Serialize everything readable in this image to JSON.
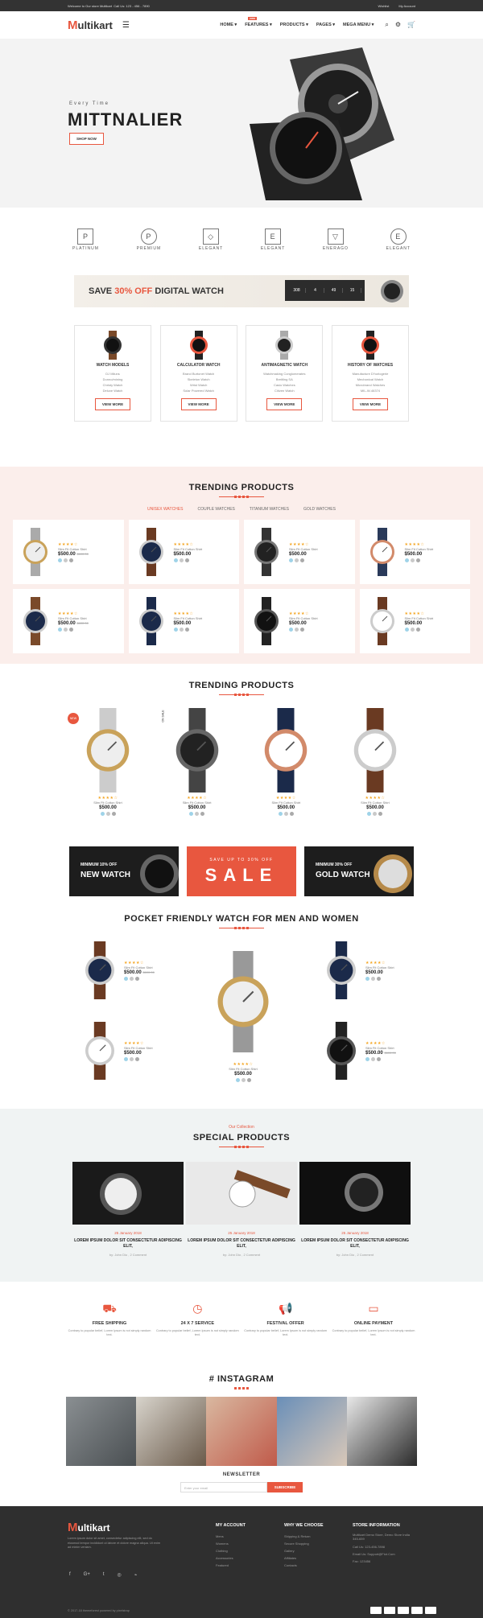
{
  "topbar": {
    "welcome": "Welcome to Our store Multikart",
    "phone": "Call Us: 123 - 456 - 7890",
    "wishlist": "Wishlist",
    "account": "My Account"
  },
  "header": {
    "logo_m": "M",
    "logo_rest": "ultikart",
    "nav": [
      "HOME",
      "FEATURES",
      "PRODUCTS",
      "PAGES",
      "MEGA MENU"
    ],
    "hot_badge": "new"
  },
  "hero": {
    "subtitle": "Every Time",
    "title": "MITTNALIER",
    "button": "SHOP NOW"
  },
  "brands": [
    {
      "mark": "P",
      "name": "PLATINUM"
    },
    {
      "mark": "P",
      "name": "PREMIUM"
    },
    {
      "mark": "◇",
      "name": "ELEGANT"
    },
    {
      "mark": "E",
      "name": "ELEGANT"
    },
    {
      "mark": "▽",
      "name": "ENERAGO"
    },
    {
      "mark": "E",
      "name": "ELEGANT"
    }
  ],
  "promo": {
    "pre": "SAVE ",
    "highlight": "30% OFF",
    "post": " DIGITAL WATCH",
    "countdown": [
      "308",
      "4",
      "49",
      "15"
    ]
  },
  "categories": [
    {
      "name": "WATCH MODELS",
      "items": [
        "DJ Miluns",
        "Dunno/mining",
        "Christy Watch",
        "Deluxe Watch"
      ],
      "button": "VIEW MORE"
    },
    {
      "name": "CALCULATOR WATCH",
      "items": [
        "Brand Burtonet Watch",
        "Skeleton Watch",
        "Wrist Watch",
        "Solar Powered Watch"
      ],
      "button": "VIEW MORE"
    },
    {
      "name": "ANTIMAGNETIC WATCH",
      "items": [
        "Watchmaking Conglomerates",
        "Breitling SA",
        "Casio Watches",
        "Citizen Watch"
      ],
      "button": "VIEW MORE"
    },
    {
      "name": "HISTORY OF WATCHES",
      "items": [
        "Manufacture D'horlogerie",
        "Mechanical Watch",
        "Microbrand Watches",
        "MIL-W-46374"
      ],
      "button": "VIEW MORE"
    }
  ],
  "trending1": {
    "title": "TRENDING PRODUCTS",
    "tabs": [
      "UNISEX WATCHES",
      "COUPLE WATCHES",
      "TITANIUM WATCHES",
      "GOLD WATCHES"
    ],
    "products": [
      {
        "name": "Slim Fit Cotton Shirt",
        "price": "$500.00",
        "old": "$600.00",
        "rating": 4
      },
      {
        "name": "Slim Fit Cotton Shirt",
        "price": "$500.00",
        "old": "",
        "rating": 4
      },
      {
        "name": "Slim Fit Cotton Shirt",
        "price": "$500.00",
        "old": "",
        "rating": 4
      },
      {
        "name": "Slim Fit Cotton Shirt",
        "price": "$500.00",
        "old": "",
        "rating": 4
      },
      {
        "name": "Slim Fit Cotton Shirt",
        "price": "$500.00",
        "old": "$600.00",
        "rating": 4
      },
      {
        "name": "Slim Fit Cotton Shirt",
        "price": "$500.00",
        "old": "",
        "rating": 4
      },
      {
        "name": "Slim Fit Cotton Shirt",
        "price": "$500.00",
        "old": "",
        "rating": 4
      },
      {
        "name": "Slim Fit Cotton Shirt",
        "price": "$500.00",
        "old": "",
        "rating": 4
      }
    ]
  },
  "trending2": {
    "title": "TRENDING PRODUCTS",
    "new_badge": "NEW",
    "sale_badge": "ON SALE",
    "products": [
      {
        "name": "Slim Fit Cotton Shirt",
        "price": "$500.00"
      },
      {
        "name": "Slim Fit Cotton Shirt",
        "price": "$500.00"
      },
      {
        "name": "Slim Fit Cotton Shirt",
        "price": "$500.00"
      },
      {
        "name": "Slim Fit Cotton Shirt",
        "price": "$500.00"
      }
    ]
  },
  "banners": [
    {
      "small": "MINIMUM 10% OFF",
      "large": "NEW WATCH"
    },
    {
      "small": "SAVE UP TO 30% OFF",
      "large": "SALE"
    },
    {
      "small": "MINIMUM 30% OFF",
      "large": "GOLD WATCH"
    }
  ],
  "pocket": {
    "title": "POCKET FRIENDLY WATCH FOR MEN AND WOMEN",
    "products": [
      {
        "name": "Slim Fit Cotton Shirt",
        "price": "$500.00",
        "old": "$600.00"
      },
      {
        "name": "Slim Fit Cotton Shirt",
        "price": "$500.00",
        "old": ""
      },
      {
        "name": "Slim Fit Cotton Shirt",
        "price": "$500.00",
        "old": ""
      },
      {
        "name": "Slim Fit Cotton Shirt",
        "price": "$500.00",
        "old": ""
      },
      {
        "name": "Slim Fit Cotton Shirt",
        "price": "$500.00",
        "old": "$600.00"
      }
    ]
  },
  "special": {
    "kicker": "Our Collection",
    "title": "SPECIAL PRODUCTS",
    "posts": [
      {
        "date": "25 January 2018",
        "heading": "LOREM IPSUM DOLOR SIT CONSECTETUR ADIPISCING ELIT,",
        "by": "by: John Dio , 2 Comment"
      },
      {
        "date": "25 January 2018",
        "heading": "LOREM IPSUM DOLOR SIT CONSECTETUR ADIPISCING ELIT,",
        "by": "by: John Dio , 2 Comment"
      },
      {
        "date": "25 January 2018",
        "heading": "LOREM IPSUM DOLOR SIT CONSECTETUR ADIPISCING ELIT,",
        "by": "by: John Dio , 2 Comment"
      }
    ]
  },
  "services": [
    {
      "icon": "truck-icon",
      "glyph": "⛟",
      "title": "FREE SHIPPING",
      "text": "Contrary to popular belief, Lorem Ipsum is not simply random text."
    },
    {
      "icon": "clock-icon",
      "glyph": "◷",
      "title": "24 X 7 SERVICE",
      "text": "Contrary to popular belief, Lorem Ipsum is not simply random text."
    },
    {
      "icon": "megaphone-icon",
      "glyph": "📢",
      "title": "FESTIVAL OFFER",
      "text": "Contrary to popular belief, Lorem Ipsum is not simply random text."
    },
    {
      "icon": "card-icon",
      "glyph": "▭",
      "title": "ONLINE PAYMENT",
      "text": "Contrary to popular belief, Lorem Ipsum is not simply random text."
    }
  ],
  "instagram": {
    "title": "# INSTAGRAM"
  },
  "newsletter": {
    "title": "NEWSLETTER",
    "placeholder": "Enter your email",
    "button": "SUBSCRIBE"
  },
  "footer": {
    "logo_m": "M",
    "logo_rest": "ultikart",
    "about": "Lorem ipsum dolor sit amet, consectetur adipiscing elit, sed do eiusmod tempor incididunt ut labore et dolore magna aliqua. Ut enim ad minim veniam.",
    "social": [
      "f",
      "G+",
      "t",
      "◎",
      "⌁"
    ],
    "col1": {
      "title": "MY ACCOUNT",
      "items": [
        "Mens",
        "Womens",
        "Clothing",
        "Accessories",
        "Featured"
      ]
    },
    "col2": {
      "title": "WHY WE CHOOSE",
      "items": [
        "Shipping & Return",
        "Secure Shopping",
        "Gallery",
        "Affiliates",
        "Contacts"
      ]
    },
    "col3": {
      "title": "STORE INFORMATION",
      "items": [
        "Multikart Demo Store, Demo Store India 345-659",
        "Call Us: 123-456-7898",
        "Email Us: Support@Fiot.Com",
        "Fax: 123456"
      ]
    },
    "copyright": "© 2017-18 themeforest powered by pixelstrap"
  },
  "colors": {
    "accent": "#e8573f",
    "dark": "#2f2f2f",
    "pink_bg": "#fbeeeb",
    "grey_bg": "#f0f3f3"
  }
}
